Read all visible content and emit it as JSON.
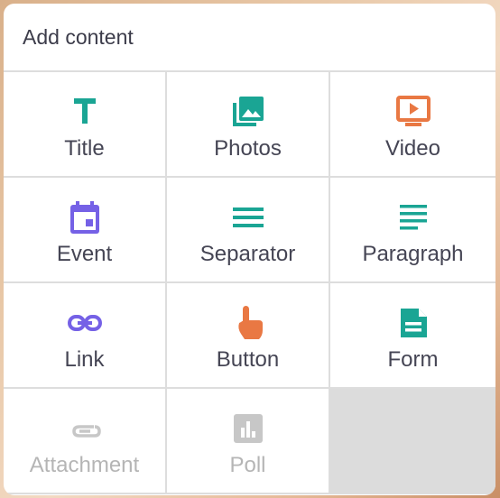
{
  "header": {
    "title": "Add content"
  },
  "colors": {
    "teal": "#1aa594",
    "orange": "#e97843",
    "purple": "#7561e6",
    "disabled": "#c7c7c7",
    "label": "#454554"
  },
  "items": [
    {
      "label": "Title",
      "icon": "title-text-icon",
      "enabled": true
    },
    {
      "label": "Photos",
      "icon": "photos-icon",
      "enabled": true
    },
    {
      "label": "Video",
      "icon": "video-icon",
      "enabled": true
    },
    {
      "label": "Event",
      "icon": "calendar-icon",
      "enabled": true
    },
    {
      "label": "Separator",
      "icon": "separator-icon",
      "enabled": true
    },
    {
      "label": "Paragraph",
      "icon": "paragraph-icon",
      "enabled": true
    },
    {
      "label": "Link",
      "icon": "link-icon",
      "enabled": true
    },
    {
      "label": "Button",
      "icon": "tap-finger-icon",
      "enabled": true
    },
    {
      "label": "Form",
      "icon": "form-document-icon",
      "enabled": true
    },
    {
      "label": "Attachment",
      "icon": "paperclip-icon",
      "enabled": false
    },
    {
      "label": "Poll",
      "icon": "poll-chart-icon",
      "enabled": false
    }
  ]
}
